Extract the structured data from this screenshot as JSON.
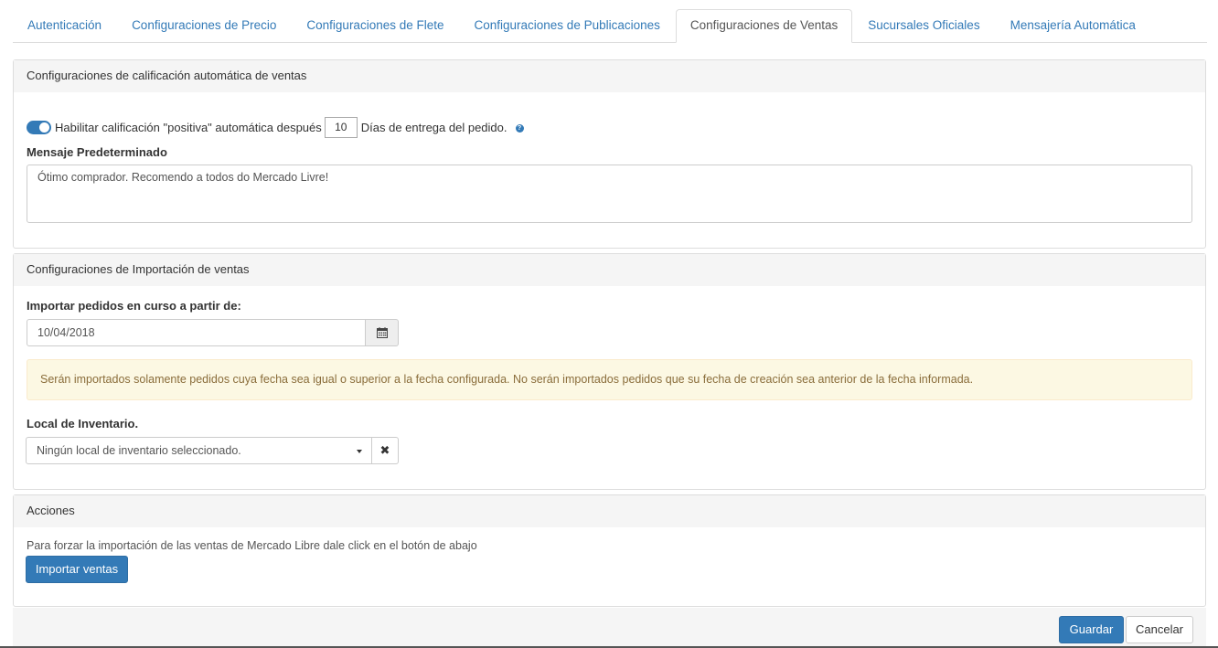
{
  "tabs": [
    {
      "label": "Autenticación",
      "active": false
    },
    {
      "label": "Configuraciones de Precio",
      "active": false
    },
    {
      "label": "Configuraciones de Flete",
      "active": false
    },
    {
      "label": "Configuraciones de Publicaciones",
      "active": false
    },
    {
      "label": "Configuraciones de Ventas",
      "active": true
    },
    {
      "label": "Sucursales Oficiales",
      "active": false
    },
    {
      "label": "Mensajería Automática",
      "active": false
    }
  ],
  "rating_panel": {
    "title": "Configuraciones de calificación automática de ventas",
    "toggle_enabled": true,
    "toggle_text_before": "Habilitar calificación \"positiva\" automática después",
    "days_value": "10",
    "toggle_text_after": "Días de entrega del pedido.",
    "help_icon": "question-circle-icon",
    "message_label": "Mensaje Predeterminado",
    "message_value": "Ótimo comprador. Recomendo a todos do Mercado Livre!"
  },
  "import_panel": {
    "title": "Configuraciones de Importación de ventas",
    "date_label": "Importar pedidos en curso a partir de:",
    "date_value": "10/04/2018",
    "calendar_icon": "calendar-icon",
    "alert_text": "Serán importados solamente pedidos cuya fecha sea igual o superior a la fecha configurada. No serán importados pedidos que su fecha de creación sea anterior de la fecha informada.",
    "inventory_label": "Local de Inventario.",
    "inventory_value": "Ningún local de inventario seleccionado.",
    "clear_icon": "close-icon"
  },
  "actions_panel": {
    "title": "Acciones",
    "description": "Para forzar la importación de las ventas de Mercado Libre dale click en el botón de abajo",
    "import_button": "Importar ventas"
  },
  "footer": {
    "save_label": "Guardar",
    "cancel_label": "Cancelar"
  },
  "colors": {
    "primary": "#337ab7",
    "alert_bg": "#fcf8e3",
    "alert_text": "#8a6d3b"
  }
}
